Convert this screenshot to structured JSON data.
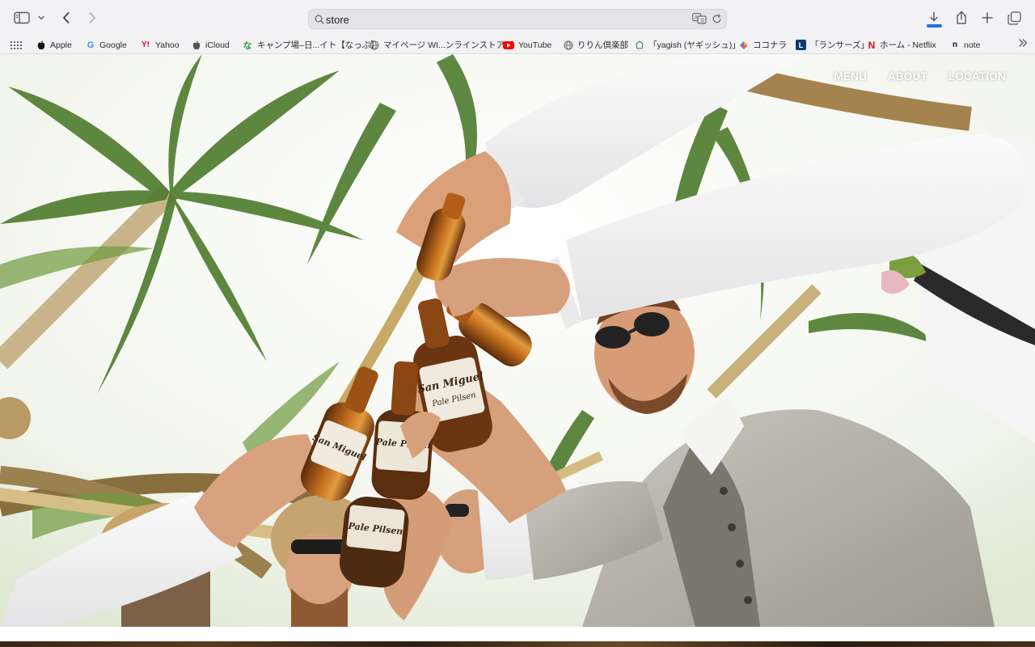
{
  "browser": {
    "address": {
      "text": "store"
    },
    "bookmarks": [
      {
        "label": "Apple",
        "icon": "apple-icon"
      },
      {
        "label": "Google",
        "icon": "google-icon"
      },
      {
        "label": "Yahoo",
        "icon": "yahoo-icon"
      },
      {
        "label": "iCloud",
        "icon": "apple-icon"
      },
      {
        "label": "キャンプ場–日...イト【なっぷ】",
        "icon": "nap-icon"
      },
      {
        "label": "マイページ WI...ンラインストア",
        "icon": "globe-icon"
      },
      {
        "label": "YouTube",
        "icon": "youtube-icon"
      },
      {
        "label": "りりん倶楽部",
        "icon": "globe-icon"
      },
      {
        "label": "「yagish (ヤギッシュ)」",
        "icon": "yagish-icon"
      },
      {
        "label": "ココナラ",
        "icon": "coconala-icon"
      },
      {
        "label": "「ランサーズ」",
        "icon": "lancers-icon"
      },
      {
        "label": "ホーム - Netflix",
        "icon": "netflix-icon"
      },
      {
        "label": "note",
        "icon": "note-icon"
      }
    ],
    "colors": {
      "download_progress": "#1a73e8",
      "chrome_bg": "#f2f2f4"
    }
  },
  "site": {
    "nav": [
      {
        "label": "MENU"
      },
      {
        "label": "ABOUT"
      },
      {
        "label": "LOCATION"
      }
    ]
  },
  "hero": {
    "bottle_labels": [
      "San Miguel",
      "Pale Pilsen"
    ]
  }
}
